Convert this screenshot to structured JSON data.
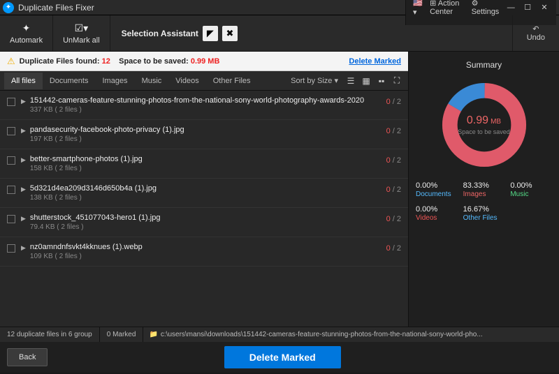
{
  "app": {
    "title": "Duplicate Files Fixer"
  },
  "titlebar_buttons": {
    "action_center": "Action Center",
    "settings": "Settings"
  },
  "toolbar": {
    "automark": "Automark",
    "unmark_all": "UnMark all",
    "selection_assistant": "Selection Assistant",
    "undo": "Undo"
  },
  "notice": {
    "found_label": "Duplicate Files found:",
    "found_count": "12",
    "space_label": "Space to be saved:",
    "space_value": "0.99 MB",
    "delete_marked": "Delete Marked"
  },
  "tabs": {
    "all": "All files",
    "documents": "Documents",
    "images": "Images",
    "music": "Music",
    "videos": "Videos",
    "other": "Other Files",
    "sort": "Sort by Size ▾"
  },
  "files": [
    {
      "name": "151442-cameras-feature-stunning-photos-from-the-national-sony-world-photography-awards-2020",
      "size": "337 KB ( 2 files )",
      "sel": "0",
      "tot": "2"
    },
    {
      "name": "pandasecurity-facebook-photo-privacy (1).jpg",
      "size": "197 KB ( 2 files )",
      "sel": "0",
      "tot": "2"
    },
    {
      "name": "better-smartphone-photos (1).jpg",
      "size": "158 KB ( 2 files )",
      "sel": "0",
      "tot": "2"
    },
    {
      "name": "5d321d4ea209d3146d650b4a (1).jpg",
      "size": "138 KB ( 2 files )",
      "sel": "0",
      "tot": "2"
    },
    {
      "name": "shutterstock_451077043-hero1 (1).jpg",
      "size": "79.4 KB ( 2 files )",
      "sel": "0",
      "tot": "2"
    },
    {
      "name": "nz0amndnfsvkt4kknues (1).webp",
      "size": "109 KB ( 2 files )",
      "sel": "0",
      "tot": "2"
    }
  ],
  "summary": {
    "title": "Summary",
    "center_value": "0.99",
    "center_unit": "MB",
    "center_label": "Space to be saved",
    "stats": {
      "documents": {
        "pct": "0.00%",
        "label": "Documents"
      },
      "images": {
        "pct": "83.33%",
        "label": "Images"
      },
      "music": {
        "pct": "0.00%",
        "label": "Music"
      },
      "videos": {
        "pct": "0.00%",
        "label": "Videos"
      },
      "other": {
        "pct": "16.67%",
        "label": "Other Files"
      }
    }
  },
  "statusbar": {
    "summary": "12 duplicate files in 6 group",
    "marked": "0 Marked",
    "path": "c:\\users\\mansi\\downloads\\151442-cameras-feature-stunning-photos-from-the-national-sony-world-pho..."
  },
  "footer": {
    "back": "Back",
    "delete": "Delete Marked"
  },
  "chart_data": {
    "type": "pie",
    "title": "Space to be saved",
    "center_value": 0.99,
    "unit": "MB",
    "series": [
      {
        "name": "Images",
        "value": 83.33,
        "color": "#e05a6a"
      },
      {
        "name": "Other Files",
        "value": 16.67,
        "color": "#3a8ad6"
      },
      {
        "name": "Documents",
        "value": 0.0,
        "color": "#5bbfff"
      },
      {
        "name": "Music",
        "value": 0.0,
        "color": "#5ad896"
      },
      {
        "name": "Videos",
        "value": 0.0,
        "color": "#e05555"
      }
    ]
  }
}
